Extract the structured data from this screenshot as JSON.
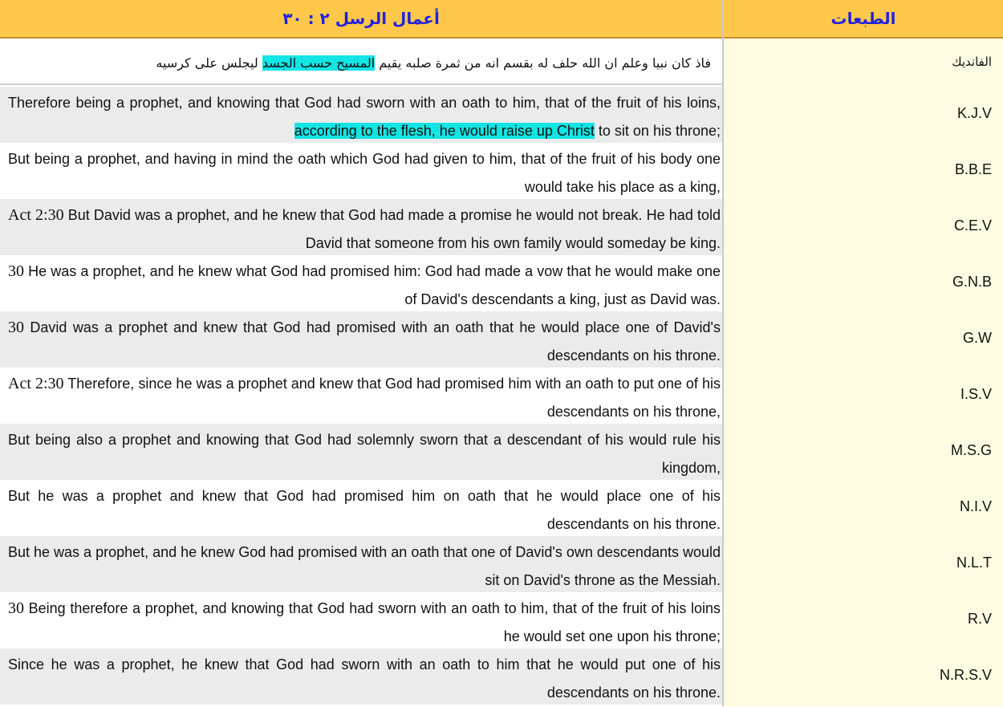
{
  "header": {
    "left_title": "أعمال الرسل ٢ : ٣٠",
    "right_title": "الطبعات"
  },
  "colors": {
    "header_bg": "#ffc84a",
    "header_text": "#2222dd",
    "highlight": "#13e4e4",
    "right_col_bg": "#fffbe2",
    "alt_row_bg": "#ebebeb"
  },
  "arabic_row": {
    "label": "الفانديك",
    "text_before": "فاذ كان نبيا وعلم ان الله حلف له بقسم انه من ثمرة صلبه يقيم ",
    "text_highlight": "المسيح حسب الجسد",
    "text_after": " ليجلس على كرسيه"
  },
  "versions": [
    {
      "label": "K.J.V",
      "ref": "",
      "before": "Therefore being a prophet, and knowing that God had sworn with an oath to him, that of the fruit of his loins, ",
      "highlight": "according to the flesh, he would raise up Christ",
      "after": " to sit on his throne;"
    },
    {
      "label": "B.B.E",
      "ref": "",
      "before": "But being a prophet, and having in mind the oath which God had given to him, that of the fruit of his body one would take his place as a king,",
      "highlight": "",
      "after": ""
    },
    {
      "label": "C.E.V",
      "ref": "Act 2:30",
      "before": " But David was a prophet, and he knew that God had made a promise he would not break. He had told David that someone from his own family would someday be king.",
      "highlight": "",
      "after": ""
    },
    {
      "label": "G.N.B",
      "ref": "30",
      "before": " He was a prophet, and he knew what God had promised him: God had made a vow that he would make one of David's descendants a king, just as David was.",
      "highlight": "",
      "after": ""
    },
    {
      "label": "G.W",
      "ref": "30",
      "before": " David was a prophet and knew that God had promised with an oath that he would place one of David's descendants on his throne.",
      "highlight": "",
      "after": ""
    },
    {
      "label": "I.S.V",
      "ref": "Act 2:30",
      "before": " Therefore, since he was a prophet and knew that God had promised him with an oath to put one of his descendants on his throne,",
      "highlight": "",
      "after": ""
    },
    {
      "label": "M.S.G",
      "ref": "",
      "before": "But being also a prophet and knowing that God had solemnly sworn that a descendant of his would rule his kingdom,",
      "highlight": "",
      "after": ""
    },
    {
      "label": "N.I.V",
      "ref": "",
      "before": "But he was a prophet and knew that God had promised him on oath that he would place one of his descendants on his throne.",
      "highlight": "",
      "after": ""
    },
    {
      "label": "N.L.T",
      "ref": "",
      "before": "But he was a prophet, and he knew God had promised with an oath that one of David's own descendants would sit on David's throne as the Messiah.",
      "highlight": "",
      "after": ""
    },
    {
      "label": "R.V",
      "ref": "30",
      "before": " Being therefore a prophet, and knowing that God had sworn with an oath to him, that of the fruit of his loins he would set one upon his throne;",
      "highlight": "",
      "after": ""
    },
    {
      "label": "N.R.S.V",
      "ref": "",
      "before": "Since he was a prophet, he knew that God had sworn with an oath to him that he would put one of his descendants on his throne.",
      "highlight": "",
      "after": ""
    }
  ]
}
